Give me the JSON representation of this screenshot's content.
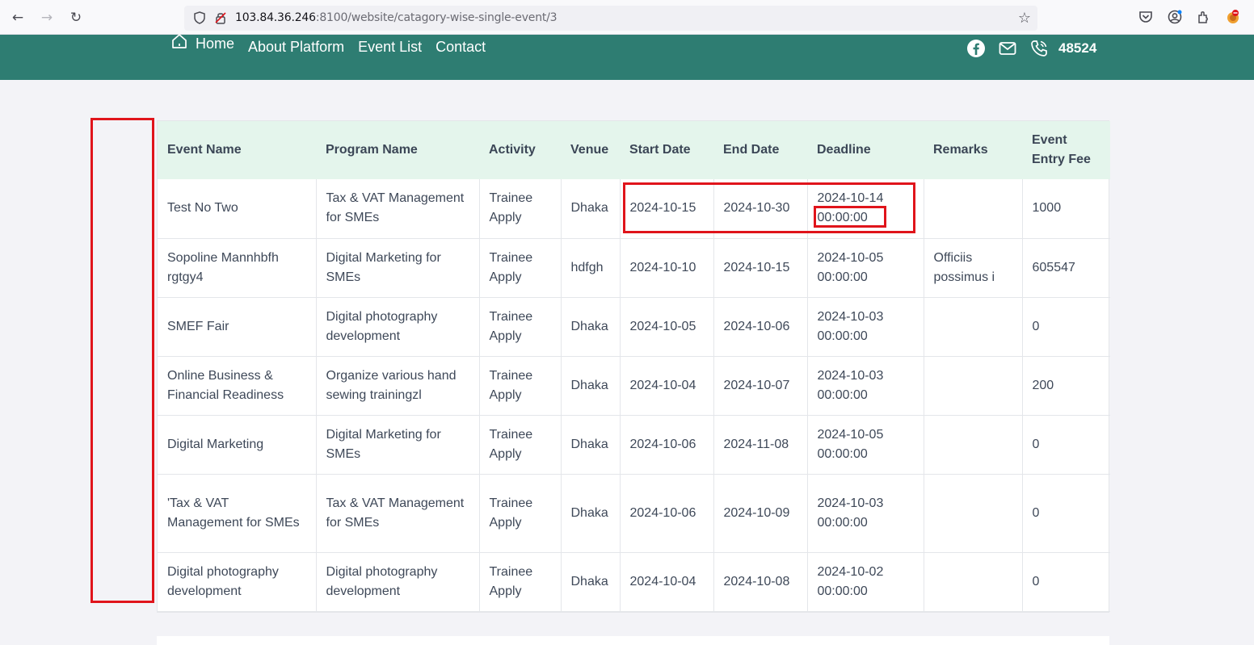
{
  "browser": {
    "url_host": "103.84.36.246",
    "url_rest": ":8100/website/catagory-wise-single-event/3"
  },
  "header": {
    "nav": {
      "home": "Home",
      "about": "About Platform",
      "events": "Event List",
      "contact": "Contact"
    },
    "phone": "48524",
    "icons": [
      "facebook-icon",
      "mail-icon",
      "phone-icon"
    ],
    "bg_color": "#2e7d72"
  },
  "table": {
    "columns": [
      "Event Name",
      "Program Name",
      "Activity",
      "Venue",
      "Start Date",
      "End Date",
      "Deadline",
      "Remarks",
      "Event Entry Fee"
    ],
    "rows": [
      {
        "event": "Test No Two",
        "program": "Tax & VAT Management for SMEs",
        "activity": "Trainee Apply",
        "venue": "Dhaka",
        "start": "2024-10-15",
        "end": "2024-10-30",
        "deadline": "2024-10-14 00:00:00",
        "remarks": "",
        "fee": "1000"
      },
      {
        "event": "Sopoline Mannhbfh rgtgy4",
        "program": "Digital Marketing for SMEs",
        "activity": "Trainee Apply",
        "venue": "hdfgh",
        "start": "2024-10-10",
        "end": "2024-10-15",
        "deadline": "2024-10-05 00:00:00",
        "remarks": "Officiis possimus i",
        "fee": "605547"
      },
      {
        "event": "SMEF Fair",
        "program": "Digital photography development",
        "activity": "Trainee Apply",
        "venue": "Dhaka",
        "start": "2024-10-05",
        "end": "2024-10-06",
        "deadline": "2024-10-03 00:00:00",
        "remarks": "",
        "fee": "0"
      },
      {
        "event": "Online Business & Financial Readiness",
        "program": "Organize various hand sewing trainingzl",
        "activity": "Trainee Apply",
        "venue": "Dhaka",
        "start": "2024-10-04",
        "end": "2024-10-07",
        "deadline": "2024-10-03 00:00:00",
        "remarks": "",
        "fee": "200"
      },
      {
        "event": "Digital Marketing",
        "program": "Digital Marketing for SMEs",
        "activity": "Trainee Apply",
        "venue": "Dhaka",
        "start": "2024-10-06",
        "end": "2024-11-08",
        "deadline": "2024-10-05 00:00:00",
        "remarks": "",
        "fee": "0"
      },
      {
        "event": "'Tax & VAT Management for SMEs",
        "program": "Tax & VAT Management for SMEs",
        "activity": "Trainee Apply",
        "venue": "Dhaka",
        "start": "2024-10-06",
        "end": "2024-10-09",
        "deadline": "2024-10-03 00:00:00",
        "remarks": "",
        "fee": "0"
      },
      {
        "event": "Digital photography development",
        "program": "Digital photography development",
        "activity": "Trainee Apply",
        "venue": "Dhaka",
        "start": "2024-10-04",
        "end": "2024-10-08",
        "deadline": "2024-10-02 00:00:00",
        "remarks": "",
        "fee": "0"
      }
    ]
  },
  "annotation_color": "#e0141b"
}
